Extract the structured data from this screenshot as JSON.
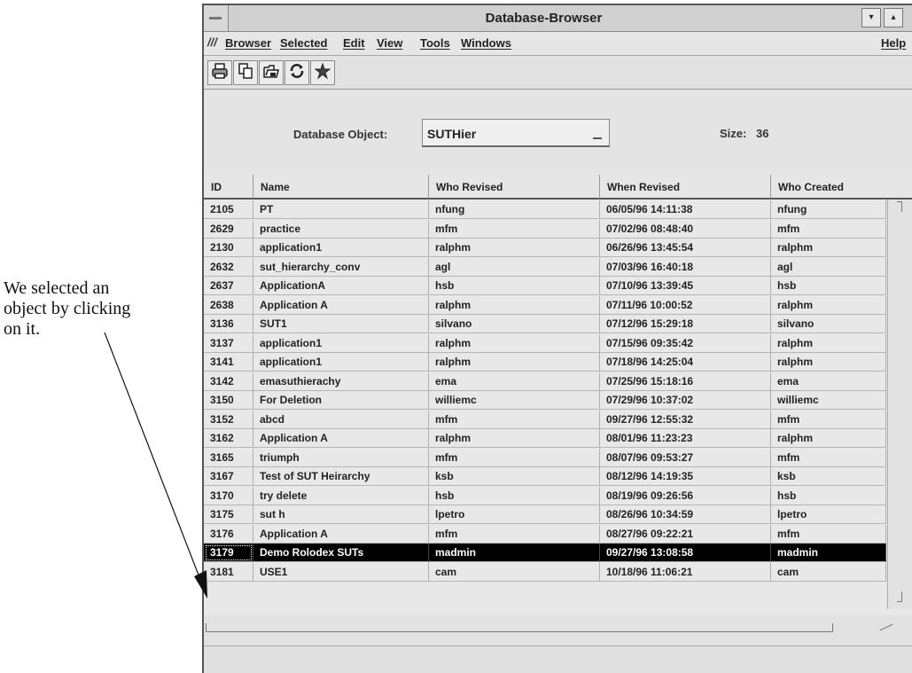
{
  "annotation": {
    "lines": [
      "We selected an",
      "object by clicking",
      "on it."
    ]
  },
  "window": {
    "title": "Database-Browser",
    "sysmenu_icon": "minus-icon",
    "title_button_down": "▾",
    "title_button_up": "▴"
  },
  "menubar": {
    "mark": "///",
    "items": [
      "Browser",
      "Selected",
      "Edit",
      "View",
      "Tools",
      "Windows"
    ],
    "help": "Help"
  },
  "toolbar": {
    "icons": [
      "print-icon",
      "copy-icon",
      "open-folder-icon",
      "refresh-icon",
      "star-icon"
    ]
  },
  "object_row": {
    "label": "Database Object:",
    "value": "SUTHier",
    "size_label": "Size:",
    "size_value": "36"
  },
  "table": {
    "columns": [
      "ID",
      "Name",
      "Who Revised",
      "When Revised",
      "Who Created"
    ],
    "rows": [
      [
        "2105",
        "PT",
        "nfung",
        "06/05/96 14:11:38",
        "nfung"
      ],
      [
        "2629",
        "practice",
        "mfm",
        "07/02/96 08:48:40",
        "mfm"
      ],
      [
        "2130",
        "application1",
        "ralphm",
        "06/26/96 13:45:54",
        "ralphm"
      ],
      [
        "2632",
        "sut_hierarchy_conv",
        "agl",
        "07/03/96 16:40:18",
        "agl"
      ],
      [
        "2637",
        "ApplicationA",
        "hsb",
        "07/10/96 13:39:45",
        "hsb"
      ],
      [
        "2638",
        "Application A",
        "ralphm",
        "07/11/96 10:00:52",
        "ralphm"
      ],
      [
        "3136",
        "SUT1",
        "silvano",
        "07/12/96 15:29:18",
        "silvano"
      ],
      [
        "3137",
        "application1",
        "ralphm",
        "07/15/96 09:35:42",
        "ralphm"
      ],
      [
        "3141",
        "application1",
        "ralphm",
        "07/18/96 14:25:04",
        "ralphm"
      ],
      [
        "3142",
        "emasuthierachy",
        "ema",
        "07/25/96 15:18:16",
        "ema"
      ],
      [
        "3150",
        "For Deletion",
        "williemc",
        "07/29/96 10:37:02",
        "williemc"
      ],
      [
        "3152",
        "abcd",
        "mfm",
        "09/27/96 12:55:32",
        "mfm"
      ],
      [
        "3162",
        "Application A",
        "ralphm",
        "08/01/96 11:23:23",
        "ralphm"
      ],
      [
        "3165",
        "triumph",
        "mfm",
        "08/07/96 09:53:27",
        "mfm"
      ],
      [
        "3167",
        "Test of SUT Heirarchy",
        "ksb",
        "08/12/96 14:19:35",
        "ksb"
      ],
      [
        "3170",
        "try delete",
        "hsb",
        "08/19/96 09:26:56",
        "hsb"
      ],
      [
        "3175",
        "sut h",
        "lpetro",
        "08/26/96 10:34:59",
        "lpetro"
      ],
      [
        "3176",
        "Application A",
        "mfm",
        "08/27/96 09:22:21",
        "mfm"
      ],
      [
        "3179",
        "Demo Rolodex SUTs",
        "madmin",
        "09/27/96 13:08:58",
        "madmin"
      ],
      [
        "3181",
        "USE1",
        "cam",
        "10/18/96 11:06:21",
        "cam"
      ]
    ],
    "selected_index": 18
  }
}
